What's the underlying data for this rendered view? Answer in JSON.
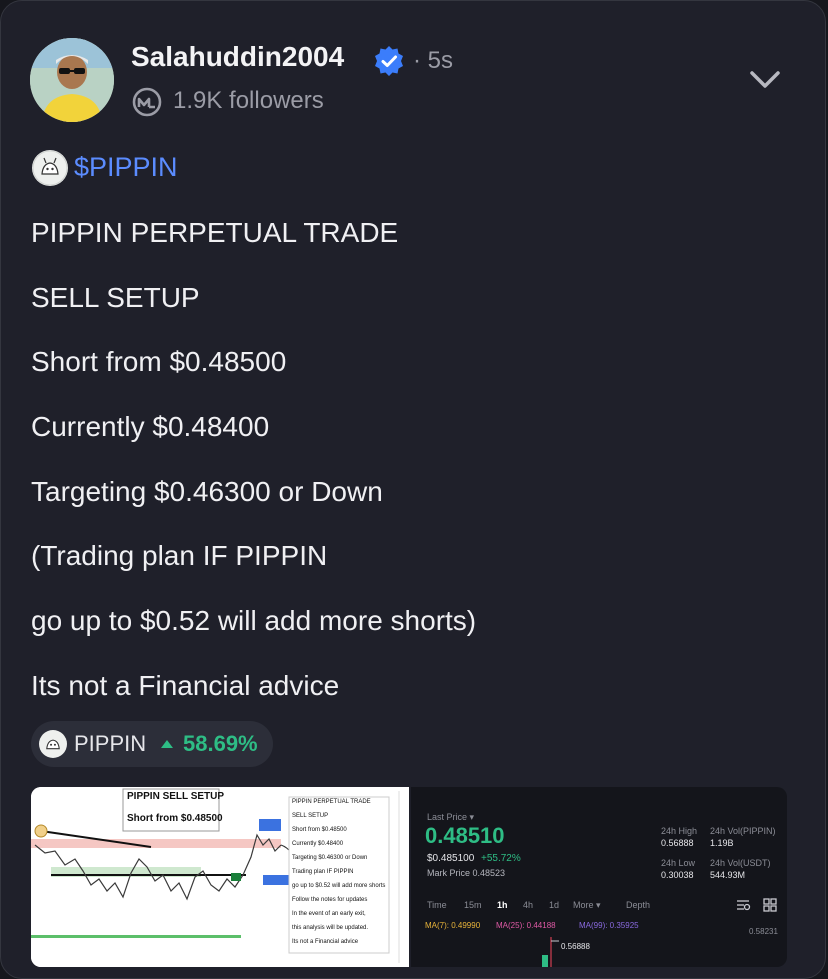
{
  "post": {
    "username": "Salahuddin2004",
    "time": "· 5s",
    "followers": "1.9K followers",
    "ticker": "$PIPPIN",
    "lines": [
      "PIPPIN PERPETUAL TRADE",
      "SELL SETUP",
      "Short from $0.48500",
      "Currently $0.48400",
      "Targeting $0.46300 or Down",
      "(Trading plan IF PIPPIN",
      "go up to $0.52 will add more shorts)",
      "Its not a Financial advice"
    ]
  },
  "coin_chip": {
    "name": "PIPPIN",
    "change": "58.69%",
    "change_color": "#2ebd85"
  },
  "left_image": {
    "title": "PIPPIN SELL SETUP",
    "subtitle": "Short from $0.48500",
    "notes": [
      "PIPPIN PERPETUAL TRADE",
      "SELL SETUP",
      "Short from $0.48500",
      "Currently $0.48400",
      "Targeting $0.46300 or Down",
      "Trading plan IF PIPPIN",
      "go up to $0.52 will add more shorts",
      "Follow the notes for updates",
      "In the event of an early exit,",
      "this analysis will be updated.",
      "Its not a Financial advice"
    ]
  },
  "right_image": {
    "last_price_label": "Last Price ▾",
    "last_price": "0.48510",
    "price_usd": "$0.485100",
    "price_change": "+55.72%",
    "mark_price": "Mark Price 0.48523",
    "high_label": "24h High",
    "high_value": "0.56888",
    "vol_coin_label": "24h Vol(PIPPIN)",
    "vol_coin_value": "1.19B",
    "low_label": "24h Low",
    "low_value": "0.30038",
    "vol_usdt_label": "24h Vol(USDT)",
    "vol_usdt_value": "544.93M",
    "timeframes": [
      "Time",
      "15m",
      "1h",
      "4h",
      "1d",
      "More ▾",
      "Depth"
    ],
    "ma7": "MA(7): 0.49990",
    "ma25": "MA(25): 0.44188",
    "ma99": "MA(99): 0.35925",
    "axis_top": "0.58231",
    "chart_high": "0.56888"
  }
}
